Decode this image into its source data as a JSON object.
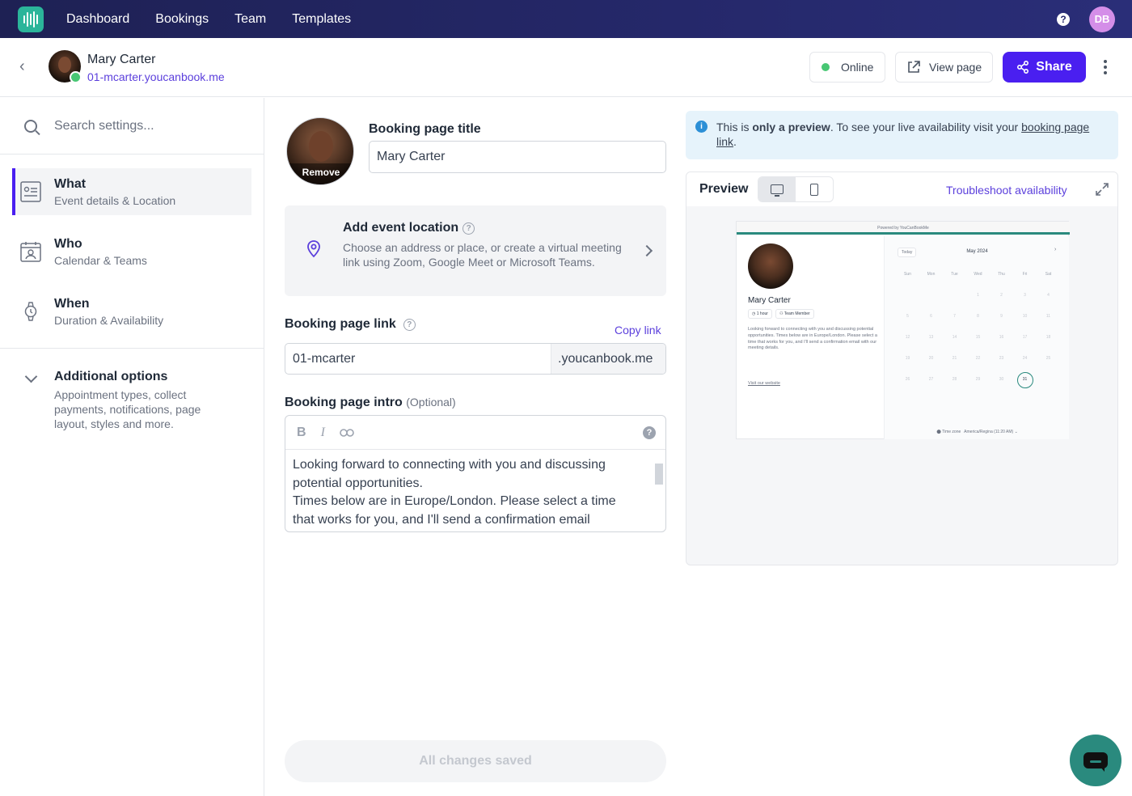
{
  "nav": {
    "links": [
      "Dashboard",
      "Bookings",
      "Team",
      "Templates"
    ],
    "help": "?",
    "user_initials": "DB"
  },
  "header": {
    "name": "Mary Carter",
    "url": "01-mcarter.youcanbook.me",
    "status_label": "Online",
    "view_page_label": "View page",
    "share_label": "Share"
  },
  "sidebar": {
    "search_placeholder": "Search settings...",
    "items": [
      {
        "title": "What",
        "sub": "Event details & Location"
      },
      {
        "title": "Who",
        "sub": "Calendar & Teams"
      },
      {
        "title": "When",
        "sub": "Duration & Availability"
      }
    ],
    "additional": {
      "title": "Additional options",
      "sub": "Appointment types, collect payments, notifications, page layout, styles and more."
    }
  },
  "form": {
    "photo_remove": "Remove",
    "title_label": "Booking page title",
    "title_value": "Mary Carter",
    "location": {
      "title": "Add event location",
      "desc": "Choose an address or place, or create a virtual meeting link using Zoom, Google Meet or Microsoft Teams."
    },
    "link_label": "Booking page link",
    "copy_link": "Copy link",
    "link_value": "01-mcarter",
    "link_suffix": ".youcanbook.me",
    "intro_label": "Booking page intro",
    "intro_optional": "(Optional)",
    "toolbar": {
      "bold": "B",
      "italic": "I"
    },
    "intro_line1": "Looking forward to connecting with you and discussing",
    "intro_line2": "potential opportunities.",
    "intro_line3": "Times below are in Europe/London. Please select a time",
    "intro_line4": "that works for you, and I'll send a confirmation email",
    "saved_label": "All changes saved"
  },
  "preview": {
    "notice_pre": "This is ",
    "notice_bold": "only a preview",
    "notice_mid": ". To see your live availability visit your ",
    "notice_link": "booking page link",
    "notice_end": ".",
    "title": "Preview",
    "troubleshoot": "Troubleshoot availability",
    "mini": {
      "powered": "Powered by YouCanBookMe",
      "name": "Mary Carter",
      "tag_duration": "1 hour",
      "tag_member": "Team Member",
      "desc": "Looking forward to connecting with you and discussing potential opportunities. Times below are in Europe/London. Please select a time that works for you, and I'll send a confirmation email with our meeting details.",
      "visit": "Visit our website",
      "today": "Today",
      "month": "May 2024",
      "next": "›",
      "dows": [
        "Sun",
        "Mon",
        "Tue",
        "Wed",
        "Thu",
        "Fri",
        "Sat"
      ],
      "weeks": [
        [
          "",
          "",
          "",
          "1",
          "2",
          "3",
          "4"
        ],
        [
          "5",
          "6",
          "7",
          "8",
          "9",
          "10",
          "11"
        ],
        [
          "12",
          "13",
          "14",
          "15",
          "16",
          "17",
          "18"
        ],
        [
          "19",
          "20",
          "21",
          "22",
          "23",
          "24",
          "25"
        ],
        [
          "26",
          "27",
          "28",
          "29",
          "30",
          "31",
          ""
        ]
      ],
      "selected_day": "31",
      "tz_label": "Time zone",
      "tz_value": "America/Regina (11:20 AM)"
    }
  },
  "colors": {
    "accent": "#4a1ff0",
    "link": "#5b3fdc",
    "teal": "#2a8a7e",
    "online": "#48c774"
  }
}
